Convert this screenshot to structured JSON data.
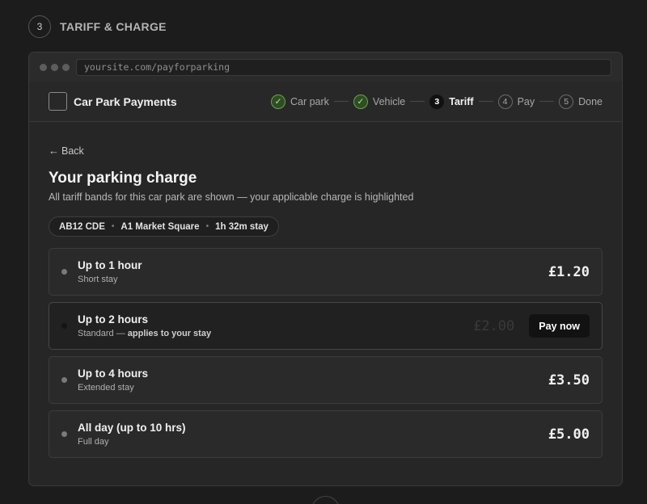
{
  "section": {
    "number": "3",
    "title": "TARIFF & CHARGE"
  },
  "browser": {
    "url": "yoursite.com/payforparking"
  },
  "app": {
    "name": "Car Park Payments"
  },
  "steps": [
    {
      "label": "Car park",
      "mark": "✓",
      "state": "done"
    },
    {
      "label": "Vehicle",
      "mark": "✓",
      "state": "done"
    },
    {
      "label": "Tariff",
      "mark": "3",
      "state": "current"
    },
    {
      "label": "Pay",
      "mark": "4",
      "state": "todo"
    },
    {
      "label": "Done",
      "mark": "5",
      "state": "todo"
    }
  ],
  "page": {
    "back_label": "Back",
    "title": "Your parking charge",
    "subtitle": "All tariff bands for this car park are shown — your applicable charge is highlighted"
  },
  "summary": {
    "plate": "AB12 CDE",
    "location": "A1 Market Square",
    "stay": "1h 32m stay"
  },
  "tariffs": [
    {
      "name": "Up to 1 hour",
      "desc": "Short stay",
      "price": "£1.20"
    },
    {
      "name": "Up to 2 hours",
      "desc": "Standard — ",
      "desc_strong": "applies to your stay",
      "price": "£2.00",
      "action": "Pay now"
    },
    {
      "name": "Up to 4 hours",
      "desc": "Extended stay",
      "price": "£3.50"
    },
    {
      "name": "All day (up to 10 hrs)",
      "desc": "Full day",
      "price": "£5.00"
    }
  ],
  "icons": {
    "back": "arrow-left-icon",
    "check": "check-icon"
  },
  "colors": {
    "accent_green": "#6aa24c",
    "background": "#1c1c1c",
    "panel": "#262626"
  }
}
